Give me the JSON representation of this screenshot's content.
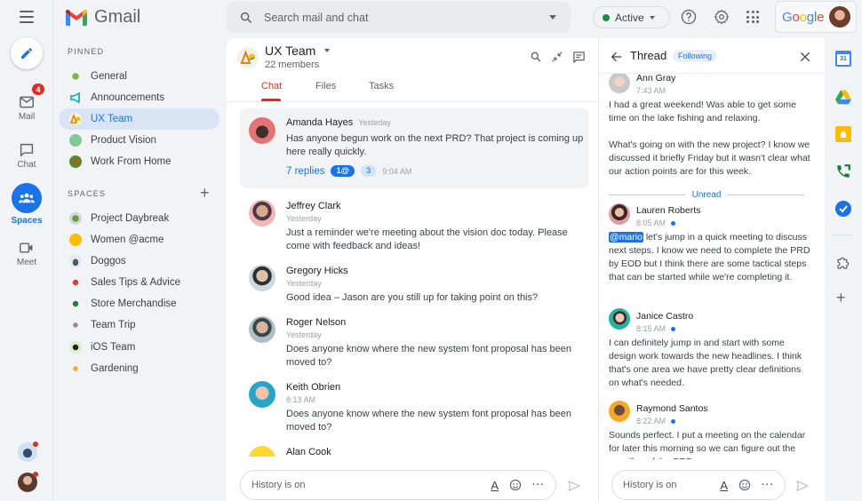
{
  "app": {
    "name": "Gmail"
  },
  "rail": {
    "items": [
      {
        "label": "Mail",
        "badge": "4"
      },
      {
        "label": "Chat"
      },
      {
        "label": "Spaces"
      },
      {
        "label": "Meet"
      }
    ]
  },
  "nav": {
    "pinned_label": "PINNED",
    "pinned": [
      {
        "label": "General"
      },
      {
        "label": "Announcements"
      },
      {
        "label": "UX Team"
      },
      {
        "label": "Product Vision"
      },
      {
        "label": "Work From Home"
      }
    ],
    "spaces_label": "SPACES",
    "spaces": [
      {
        "label": "Project Daybreak"
      },
      {
        "label": "Women @acme"
      },
      {
        "label": "Doggos"
      },
      {
        "label": "Sales Tips & Advice"
      },
      {
        "label": "Store Merchandise"
      },
      {
        "label": "Team Trip"
      },
      {
        "label": "iOS Team"
      },
      {
        "label": "Gardening"
      }
    ]
  },
  "topbar": {
    "search_placeholder": "Search mail and chat",
    "status": "Active",
    "status_color": "#1e8e3e",
    "google_label": "Google"
  },
  "chat": {
    "title": "UX Team",
    "members": "22 members",
    "tabs": [
      {
        "label": "Chat"
      },
      {
        "label": "Files"
      },
      {
        "label": "Tasks"
      }
    ],
    "highlighted": {
      "name": "Amanda Hayes",
      "time": "Yesteday",
      "text": "Has anyone begun work on the next PRD? That project is coming up here really quickly.",
      "replies": "7 replies",
      "mention_badge": "1@",
      "unread_badge": "3",
      "reply_time": "9:04 AM"
    },
    "messages": [
      {
        "name": "Jeffrey Clark",
        "time": "Yesterday",
        "text": "Just a reminder we're meeting about the vision doc today. Please come with feedback and ideas!"
      },
      {
        "name": "Gregory Hicks",
        "time": "Yesterday",
        "text": "Good idea – Jason are you still up for taking point on this?"
      },
      {
        "name": "Roger Nelson",
        "time": "Yesterday",
        "text": "Does anyone know where the new system font proposal has been moved to?"
      },
      {
        "name": "Keith Obrien",
        "time": "8:13 AM",
        "text": "Does anyone know where the new system font proposal has been moved to?"
      },
      {
        "name": "Alan Cook",
        "time": "",
        "text": ""
      }
    ],
    "composer_placeholder": "History is on"
  },
  "thread": {
    "title": "Thread",
    "following": "Following",
    "unread_label": "Unread",
    "messages": [
      {
        "name": "Ann Gray",
        "time": "7:43 AM",
        "text": "I had a great weekend! Was able to get some time on the lake fishing and relaxing.",
        "text2": "What's going on with the new project? I know we discussed it briefly Friday but it wasn't clear what our action points are for this week."
      },
      {
        "name": "Lauren Roberts",
        "time": "8:05 AM",
        "mention": "@mario",
        "text": "let's jump in a quick meeting to discuss next steps. I know we need to complete the PRD by EOD but I think there are some tactical steps that can be started while we're completing it."
      },
      {
        "name": "Janice Castro",
        "time": "8:15 AM",
        "text": "I can definitely jump in and start with some design work towards the new headlines. I think that's one area we have pretty clear definitions on what's needed."
      },
      {
        "name": "Raymond Santos",
        "time": "8:22 AM",
        "text": "Sounds perfect. I put a meeting on the calendar for later this morning so we can figure out the specifics of the PRD."
      }
    ],
    "composer_placeholder": "History is on"
  },
  "right_rail": {
    "apps": [
      "Calendar",
      "Drive",
      "Keep",
      "Voice",
      "Tasks"
    ],
    "calendar_day": "31"
  }
}
